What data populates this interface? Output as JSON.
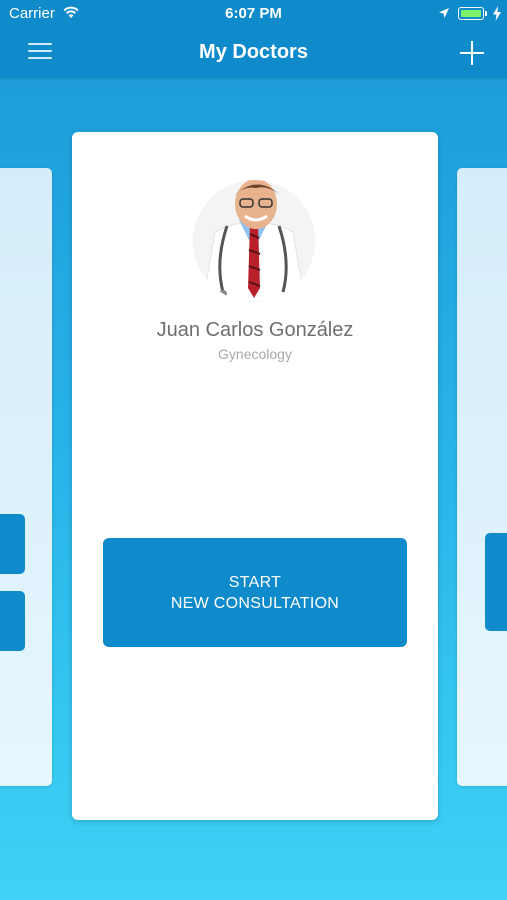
{
  "status_bar": {
    "carrier": "Carrier",
    "time": "6:07 PM"
  },
  "nav_bar": {
    "title": "My Doctors"
  },
  "doctor_card": {
    "name": "Juan Carlos González",
    "specialty": "Gynecology",
    "cta_line1": "START",
    "cta_line2": "NEW CONSULTATION"
  },
  "colors": {
    "primary": "#0f8acb",
    "background_top": "#1b98d6",
    "background_bottom": "#3ed3f6",
    "battery": "#7ff26b"
  },
  "icons": {
    "menu": "hamburger-menu-icon",
    "add": "plus-icon",
    "wifi": "wifi-icon",
    "location": "location-arrow-icon",
    "battery": "battery-icon",
    "charging": "charging-bolt-icon"
  }
}
